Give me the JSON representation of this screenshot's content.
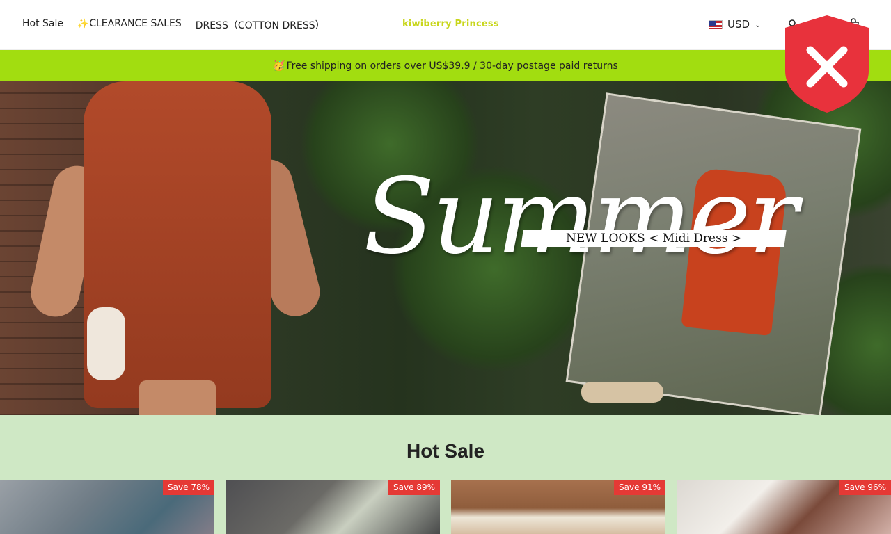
{
  "header": {
    "nav": [
      {
        "label": "Hot Sale"
      },
      {
        "icon": "sparkle",
        "label": "CLEARANCE SALES"
      },
      {
        "label": "DRESS（COTTON DRESS）"
      }
    ],
    "logo": "kiwiberry Princess",
    "currency": {
      "flag": "us-flag-icon",
      "label": "USD"
    },
    "icons": [
      "account-icon",
      "cart-icon"
    ]
  },
  "announcement": {
    "emoji": "🥳",
    "text": "Free shipping on orders over US$39.9 / 30-day postage paid returns"
  },
  "hero": {
    "badge_text": "NEW LOOKS < Midi Dress >",
    "headline": "Summer"
  },
  "security_overlay": {
    "icon": "shield-x-icon",
    "colors": {
      "shield": "#e8323c",
      "mark": "#ffffff"
    }
  },
  "hot_sale": {
    "title": "Hot Sale",
    "products": [
      {
        "badge": "Save 78%"
      },
      {
        "badge": "Save 89%"
      },
      {
        "badge": "Save 91%"
      },
      {
        "badge": "Save 96%"
      }
    ]
  },
  "colors": {
    "announcement_bg": "#a2dd10",
    "section_bg": "#cfe8c5",
    "badge_bg": "#e53935",
    "logo": "#c8d61b"
  }
}
